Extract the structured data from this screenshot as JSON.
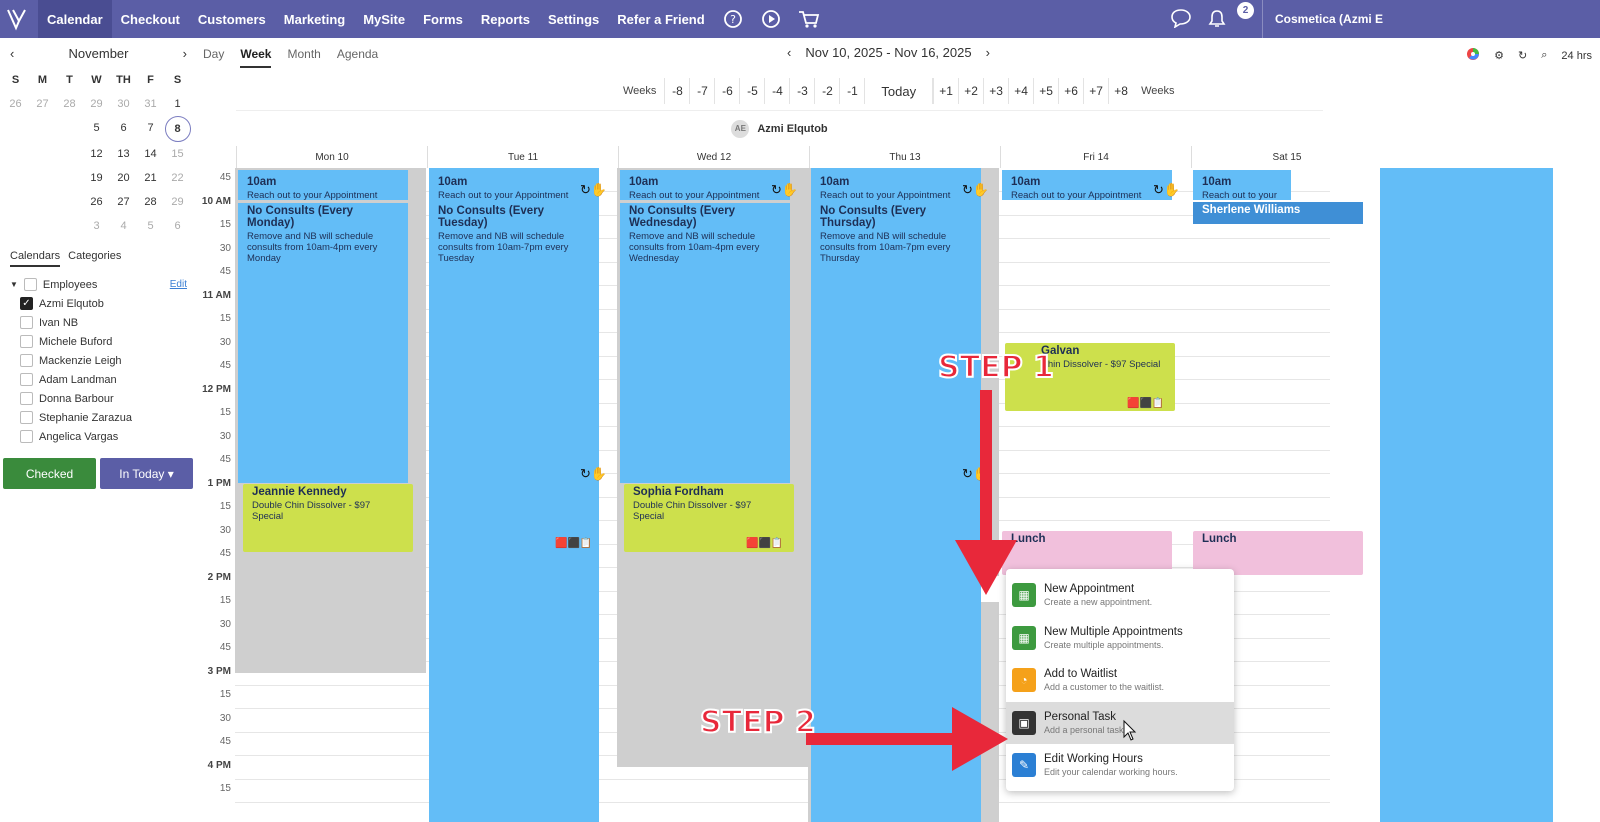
{
  "nav": {
    "items": [
      "Calendar",
      "Checkout",
      "Customers",
      "Marketing",
      "MySite",
      "Forms",
      "Reports",
      "Settings",
      "Refer a Friend"
    ],
    "notif_count": "2",
    "account": "Cosmetica (Azmi E"
  },
  "mini": {
    "month": "November",
    "dow": [
      "S",
      "M",
      "T",
      "W",
      "TH",
      "F",
      "S"
    ],
    "rows": [
      [
        "26",
        "27",
        "28",
        "29",
        "30",
        "31",
        "1"
      ],
      [
        "",
        "",
        "",
        "5",
        "6",
        "7",
        "8"
      ],
      [
        "",
        "",
        "",
        "12",
        "13",
        "14",
        "15"
      ],
      [
        "",
        "",
        "",
        "19",
        "20",
        "21",
        "22"
      ],
      [
        "",
        "",
        "",
        "26",
        "27",
        "28",
        "29"
      ],
      [
        "",
        "",
        "",
        "3",
        "4",
        "5",
        "6"
      ]
    ],
    "selected": "8"
  },
  "side": {
    "tab1": "Calendars",
    "tab2": "Categories",
    "group": "Employees",
    "edit": "Edit",
    "employees": [
      "Azmi Elqutob",
      "Ivan NB",
      "Michele Buford",
      "Mackenzie Leigh",
      "Adam Landman",
      "Donna Barbour",
      "Stephanie Zarazua",
      "Angelica Vargas"
    ],
    "btn_checked": "Checked",
    "btn_today": "In Today ▾"
  },
  "view": {
    "tabs": [
      "Day",
      "Week",
      "Month",
      "Agenda"
    ],
    "active": "Week",
    "range": "Nov 10, 2025 - Nov 16, 2025",
    "hrs": "24 hrs"
  },
  "weeks": {
    "label": "Weeks",
    "items": [
      "-8",
      "-7",
      "-6",
      "-5",
      "-4",
      "-3",
      "-2",
      "-1",
      "Today",
      "+1",
      "+2",
      "+3",
      "+4",
      "+5",
      "+6",
      "+7",
      "+8"
    ]
  },
  "employee": {
    "initials": "AE",
    "name": "Azmi Elqutob"
  },
  "days": [
    "Mon 10",
    "Tue 11",
    "Wed 12",
    "Thu 13",
    "Fri 14",
    "Sat 15"
  ],
  "times": [
    "45",
    "10 AM",
    "15",
    "30",
    "45",
    "11 AM",
    "15",
    "30",
    "45",
    "12 PM",
    "15",
    "30",
    "45",
    "1 PM",
    "15",
    "30",
    "45",
    "2 PM",
    "15",
    "30",
    "45",
    "3 PM",
    "15",
    "30",
    "45",
    "4 PM",
    "15"
  ],
  "events": {
    "top_title": "10am",
    "top_desc": "Reach out to your Appointment",
    "mon_title": "No Consults (Every Monday)",
    "mon_desc": "Remove and NB will schedule consults from 10am-4pm every Monday",
    "tue_title": "No Consults (Every Tuesday)",
    "tue_desc": "Remove and NB will schedule consults from 10am-7pm every Tuesday",
    "wed_title": "No Consults (Every Wednesday)",
    "wed_desc": "Remove and NB will schedule consults from 10am-4pm every Wednesday",
    "thu_title": "No Consults (Every Thursday)",
    "thu_desc": "Remove and NB will schedule consults from 10am-7pm every Thursday",
    "sat_name": "Sherlene Williams",
    "jeannie": "Jeannie Kennedy",
    "sophia": "Sophia Fordham",
    "galvan": "Galvan",
    "service": "Double Chin Dissolver - $97 Special",
    "service_short": "Chin Dissolver - $97 Special",
    "lunch": "Lunch"
  },
  "menu": [
    {
      "title": "New Appointment",
      "desc": "Create a new appointment.",
      "color": "#3d9a3f"
    },
    {
      "title": "New Multiple Appointments",
      "desc": "Create multiple appointments.",
      "color": "#3d9a3f"
    },
    {
      "title": "Add to Waitlist",
      "desc": "Add a customer to the waitlist.",
      "color": "#f5a11a"
    },
    {
      "title": "Personal Task",
      "desc": "Add a personal task.",
      "color": "#333333"
    },
    {
      "title": "Edit Working Hours",
      "desc": "Edit your calendar working hours.",
      "color": "#2b7fd4"
    }
  ],
  "steps": {
    "s1": "STEP 1",
    "s2": "STEP 2"
  }
}
